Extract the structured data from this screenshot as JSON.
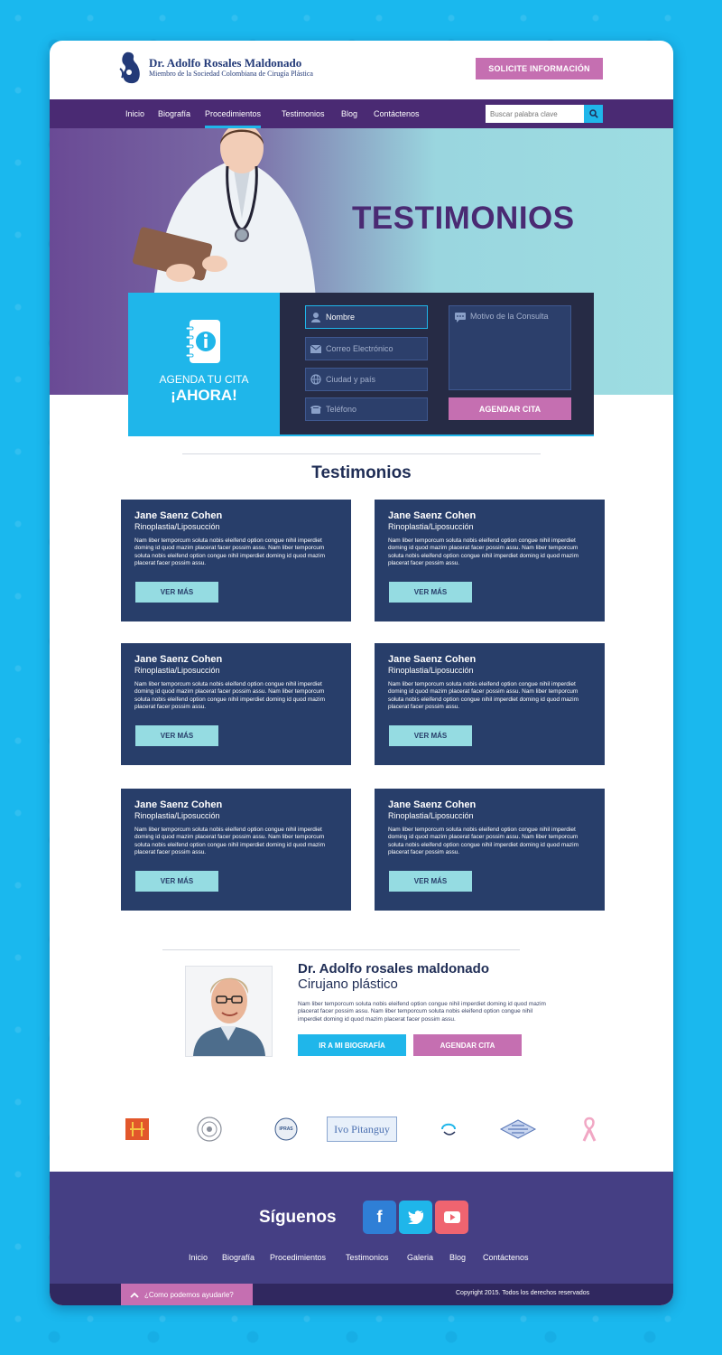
{
  "header": {
    "logo_name": "Dr. Adolfo Rosales Maldonado",
    "logo_subtitle": "Miembro de la Sociedad Colombiana de Cirugía Plástica",
    "cta_label": "SOLICITE INFORMACIÓN"
  },
  "nav": {
    "items": [
      "Inicio",
      "Biografía",
      "Procedimientos",
      "Testimonios",
      "Blog",
      "Contáctenos"
    ],
    "active": "Procedimientos",
    "search_placeholder": "Buscar palabra clave"
  },
  "hero": {
    "title": "TESTIMONIOS"
  },
  "appointment": {
    "line1": "AGENDA TU CITA",
    "line2": "¡AHORA!",
    "fields": {
      "name_value": "Nombre",
      "email_placeholder": "Correo Electrónico",
      "city_placeholder": "Ciudad y país",
      "phone_placeholder": "Teléfono",
      "reason_placeholder": "Motivo de la Consulta"
    },
    "submit_label": "AGENDAR CITA"
  },
  "testimonials": {
    "title": "Testimonios",
    "items": [
      {
        "name": "Jane Saenz Cohen",
        "procedure": "Rinoplastia/Liposucción",
        "text": "Nam liber temporcum soluta nobis eleifend option congue nihil imperdiet doming id quod mazim placerat facer possim assu. Nam liber temporcum soluta nobis eleifend option congue nihil imperdiet doming id quod mazim placerat facer possim assu.",
        "button": "VER MÁS"
      },
      {
        "name": "Jane Saenz Cohen",
        "procedure": "Rinoplastia/Liposucción",
        "text": "Nam liber temporcum soluta nobis eleifend option congue nihil imperdiet doming id quod mazim placerat facer possim assu. Nam liber temporcum soluta nobis eleifend option congue nihil imperdiet doming id quod mazim placerat facer possim assu.",
        "button": "VER MÁS"
      },
      {
        "name": "Jane Saenz Cohen",
        "procedure": "Rinoplastia/Liposucción",
        "text": "Nam liber temporcum soluta nobis eleifend option congue nihil imperdiet doming id quod mazim placerat facer possim assu. Nam liber temporcum soluta nobis eleifend option congue nihil imperdiet doming id quod mazim placerat facer possim assu.",
        "button": "VER MÁS"
      },
      {
        "name": "Jane Saenz Cohen",
        "procedure": "Rinoplastia/Liposucción",
        "text": "Nam liber temporcum soluta nobis eleifend option congue nihil imperdiet doming id quod mazim placerat facer possim assu. Nam liber temporcum soluta nobis eleifend option congue nihil imperdiet doming id quod mazim placerat facer possim assu.",
        "button": "VER MÁS"
      },
      {
        "name": "Jane Saenz Cohen",
        "procedure": "Rinoplastia/Liposucción",
        "text": "Nam liber temporcum soluta nobis eleifend option congue nihil imperdiet doming id quod mazim placerat facer possim assu. Nam liber temporcum soluta nobis eleifend option congue nihil imperdiet doming id quod mazim placerat facer possim assu.",
        "button": "VER MÁS"
      },
      {
        "name": "Jane Saenz Cohen",
        "procedure": "Rinoplastia/Liposucción",
        "text": "Nam liber temporcum soluta nobis eleifend option congue nihil imperdiet doming id quod mazim placerat facer possim assu. Nam liber temporcum soluta nobis eleifend option congue nihil imperdiet doming id quod mazim placerat facer possim assu.",
        "button": "VER MÁS"
      }
    ]
  },
  "doctor": {
    "name": "Dr. Adolfo rosales maldonado",
    "role": "Cirujano plástico",
    "bio": "Nam liber temporcum soluta nobis eleifend option congue nihil imperdiet doming id quod mazim placerat facer possim assu. Nam liber temporcum soluta nobis eleifend option congue nihil imperdiet doming id quod mazim placerat facer possim assu.",
    "bio_button": "IR A MI BIOGRAFÍA",
    "appointment_button": "AGENDAR CITA"
  },
  "partners": {
    "ipras": "IPRAS",
    "pitanguy": "Ivo Pitanguy"
  },
  "footer": {
    "follow_title": "Síguenos",
    "social": [
      "facebook-icon",
      "twitter-icon",
      "youtube-icon"
    ],
    "links": [
      "Inicio",
      "Biografía",
      "Procedimientos",
      "Testimonios",
      "Galeria",
      "Blog",
      "Contáctenos"
    ],
    "help_label": "¿Como podemos ayudarle?",
    "copyright": "Copyright 2015. Todos los derechos reservados"
  },
  "colors": {
    "purple": "#4a2a73",
    "cyan": "#1fb6ea",
    "pink": "#c56fb1",
    "navy_card": "#283e6a",
    "footer": "#453f84"
  }
}
